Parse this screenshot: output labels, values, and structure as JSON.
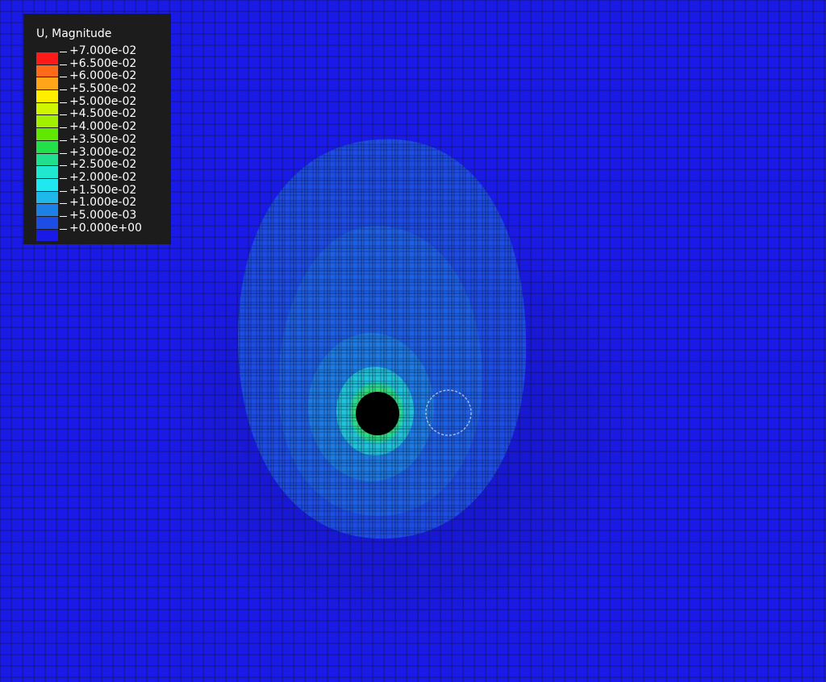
{
  "legend": {
    "title": "U, Magnitude",
    "labels": [
      "+7.000e-02",
      "+6.500e-02",
      "+6.000e-02",
      "+5.500e-02",
      "+5.000e-02",
      "+4.500e-02",
      "+4.000e-02",
      "+3.500e-02",
      "+3.000e-02",
      "+2.500e-02",
      "+2.000e-02",
      "+1.500e-02",
      "+1.000e-02",
      "+5.000e-03",
      "+0.000e+00"
    ],
    "bin_colors": [
      "#ff1a1a",
      "#ff6a1a",
      "#ffa51a",
      "#ffee00",
      "#d0f500",
      "#a0f000",
      "#60e800",
      "#22e04a",
      "#20e090",
      "#20e8d0",
      "#20e8f0",
      "#20b8ea",
      "#1c80e6",
      "#1c4ee6",
      "#1a1ae6"
    ]
  },
  "contour_colors": {
    "background": "#1a1ae6",
    "shade_level_1": "#1c4ee6",
    "shade_level_2": "#1e7ee0",
    "shade_level_3": "#20c4d8",
    "shade_level_4": "#22d8a8",
    "peak": "#40e040",
    "hole": "#000000",
    "mesh_lines": "#111133"
  }
}
